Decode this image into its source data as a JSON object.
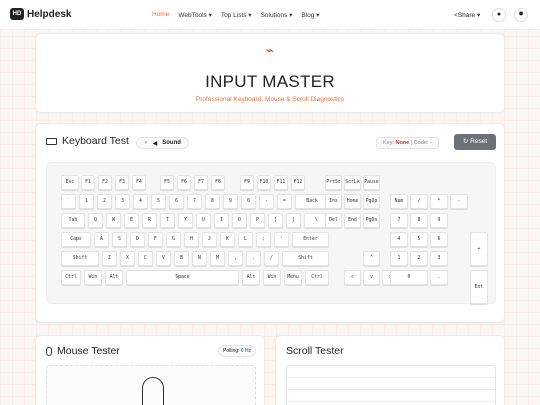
{
  "nav": {
    "logo": "Helpdesk",
    "items": [
      "Home",
      "WebTools",
      "Top Lists",
      "Solutions",
      "Blog"
    ],
    "share": "Share"
  },
  "hero": {
    "title": "INPUT MASTER",
    "subtitle": "Professional Keyboard, Mouse & Scroll Diagnostics"
  },
  "keyboard": {
    "title": "Keyboard Test",
    "sound": "Sound",
    "key_label": "Key:",
    "key_value": "None",
    "code_label": "Code:",
    "code_value": "-",
    "reset": "Reset"
  },
  "keys": [
    [
      "Esc",
      14,
      12,
      18
    ],
    [
      "F1",
      34,
      12,
      14
    ],
    [
      "F2",
      51,
      12,
      14
    ],
    [
      "F3",
      68,
      12,
      14
    ],
    [
      "F4",
      85,
      12,
      14
    ],
    [
      "F5",
      113,
      12,
      14
    ],
    [
      "F6",
      130,
      12,
      14
    ],
    [
      "F7",
      147,
      12,
      14
    ],
    [
      "F8",
      164,
      12,
      14
    ],
    [
      "F9",
      193,
      12,
      14
    ],
    [
      "F10",
      210,
      12,
      14
    ],
    [
      "F11",
      227,
      12,
      14
    ],
    [
      "F12",
      244,
      12,
      14
    ],
    [
      "PrtSc",
      278,
      12,
      17
    ],
    [
      "ScrLk",
      297,
      12,
      17
    ],
    [
      "Pause",
      316,
      12,
      17
    ],
    [
      "`",
      14,
      31,
      15
    ],
    [
      "1",
      32,
      31,
      15
    ],
    [
      "2",
      50,
      31,
      15
    ],
    [
      "3",
      68,
      31,
      15
    ],
    [
      "4",
      86,
      31,
      15
    ],
    [
      "5",
      104,
      31,
      15
    ],
    [
      "6",
      122,
      31,
      15
    ],
    [
      "7",
      140,
      31,
      15
    ],
    [
      "8",
      158,
      31,
      15
    ],
    [
      "9",
      176,
      31,
      15
    ],
    [
      "0",
      194,
      31,
      15
    ],
    [
      "-",
      212,
      31,
      15
    ],
    [
      "=",
      230,
      31,
      15
    ],
    [
      "Back",
      248,
      31,
      34
    ],
    [
      "Ins",
      278,
      31,
      17
    ],
    [
      "Home",
      297,
      31,
      17
    ],
    [
      "PgUp",
      316,
      31,
      17
    ],
    [
      "Num",
      343,
      31,
      18
    ],
    [
      "/",
      363,
      31,
      18
    ],
    [
      "*",
      383,
      31,
      18
    ],
    [
      "-",
      403,
      31,
      18
    ],
    [
      "Tab",
      14,
      50,
      24
    ],
    [
      "Q",
      41,
      50,
      15
    ],
    [
      "W",
      59,
      50,
      15
    ],
    [
      "E",
      77,
      50,
      15
    ],
    [
      "R",
      95,
      50,
      15
    ],
    [
      "T",
      113,
      50,
      15
    ],
    [
      "Y",
      131,
      50,
      15
    ],
    [
      "U",
      149,
      50,
      15
    ],
    [
      "I",
      167,
      50,
      15
    ],
    [
      "O",
      185,
      50,
      15
    ],
    [
      "P",
      203,
      50,
      15
    ],
    [
      "[",
      221,
      50,
      15
    ],
    [
      "]",
      239,
      50,
      15
    ],
    [
      "\\",
      257,
      50,
      25
    ],
    [
      "Del",
      278,
      50,
      17
    ],
    [
      "End",
      297,
      50,
      17
    ],
    [
      "PgDn",
      316,
      50,
      17
    ],
    [
      "7",
      343,
      50,
      18
    ],
    [
      "8",
      363,
      50,
      18
    ],
    [
      "9",
      383,
      50,
      18
    ],
    [
      "Caps",
      14,
      69,
      30
    ],
    [
      "A",
      47,
      69,
      15
    ],
    [
      "S",
      65,
      69,
      15
    ],
    [
      "D",
      83,
      69,
      15
    ],
    [
      "F",
      101,
      69,
      15
    ],
    [
      "G",
      119,
      69,
      15
    ],
    [
      "H",
      137,
      69,
      15
    ],
    [
      "J",
      155,
      69,
      15
    ],
    [
      "K",
      173,
      69,
      15
    ],
    [
      "L",
      191,
      69,
      15
    ],
    [
      ";",
      209,
      69,
      15
    ],
    [
      "'",
      227,
      69,
      15
    ],
    [
      "Enter",
      245,
      69,
      37
    ],
    [
      "4",
      343,
      69,
      18
    ],
    [
      "5",
      363,
      69,
      18
    ],
    [
      "6",
      383,
      69,
      18
    ],
    [
      "Shift",
      14,
      88,
      38
    ],
    [
      "Z",
      55,
      88,
      15
    ],
    [
      "X",
      73,
      88,
      15
    ],
    [
      "C",
      91,
      88,
      15
    ],
    [
      "V",
      109,
      88,
      15
    ],
    [
      "B",
      127,
      88,
      15
    ],
    [
      "N",
      145,
      88,
      15
    ],
    [
      "M",
      163,
      88,
      15
    ],
    [
      ",",
      181,
      88,
      15
    ],
    [
      ".",
      199,
      88,
      15
    ],
    [
      "/",
      217,
      88,
      15
    ],
    [
      "Shift",
      235,
      88,
      47
    ],
    [
      "^",
      316,
      88,
      17
    ],
    [
      "1",
      343,
      88,
      18
    ],
    [
      "2",
      363,
      88,
      18
    ],
    [
      "3",
      383,
      88,
      18
    ],
    [
      "Ctrl",
      14,
      107,
      20
    ],
    [
      "Win",
      37,
      107,
      18
    ],
    [
      "Alt",
      58,
      107,
      18
    ],
    [
      "Space",
      79,
      107,
      113
    ],
    [
      "Alt",
      195,
      107,
      18
    ],
    [
      "Win",
      216,
      107,
      18
    ],
    [
      "Menu",
      237,
      107,
      18
    ],
    [
      "Ctrl",
      258,
      107,
      24
    ],
    [
      "<",
      297,
      107,
      17
    ],
    [
      "v",
      316,
      107,
      17
    ],
    [
      ">",
      335,
      107,
      17
    ],
    [
      "0",
      343,
      107,
      38
    ],
    [
      ".",
      383,
      107,
      18
    ]
  ],
  "mouse": {
    "title": "Mouse Tester",
    "polling_label": "Polling:",
    "polling_value": "0 Hz"
  },
  "scroll": {
    "title": "Scroll Tester"
  }
}
